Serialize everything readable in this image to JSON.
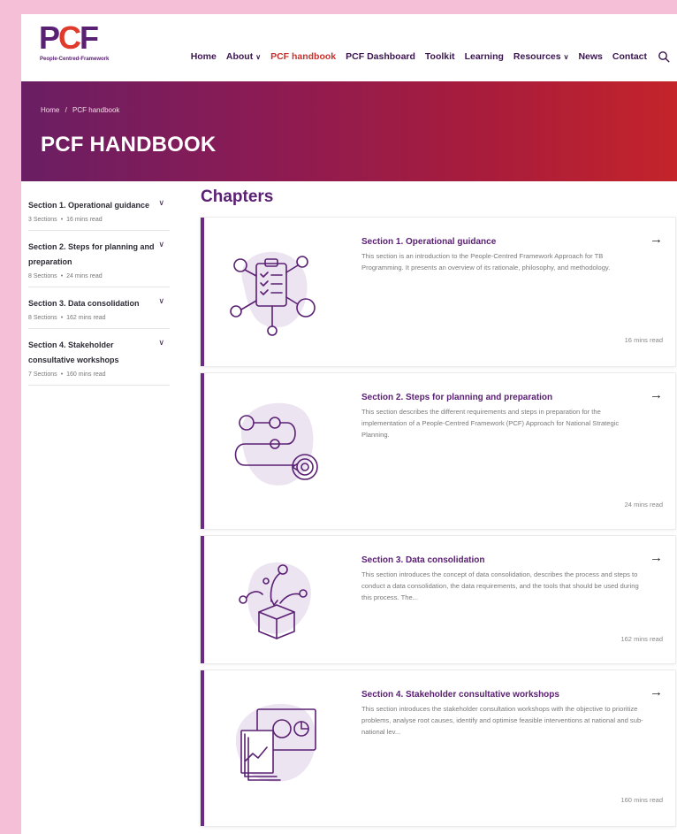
{
  "logo": {
    "letters_1": "P",
    "letters_2": "C",
    "letters_3": "F",
    "subtitle": "People-Centred-Framework"
  },
  "nav": {
    "items": [
      {
        "label": "Home",
        "dropdown": false,
        "active": false
      },
      {
        "label": "About",
        "dropdown": true,
        "active": false
      },
      {
        "label": "PCF handbook",
        "dropdown": false,
        "active": true
      },
      {
        "label": "PCF Dashboard",
        "dropdown": false,
        "active": false
      },
      {
        "label": "Toolkit",
        "dropdown": false,
        "active": false
      },
      {
        "label": "Learning",
        "dropdown": false,
        "active": false
      },
      {
        "label": "Resources",
        "dropdown": true,
        "active": false
      },
      {
        "label": "News",
        "dropdown": false,
        "active": false
      },
      {
        "label": "Contact",
        "dropdown": false,
        "active": false
      }
    ],
    "chevron": "∨"
  },
  "breadcrumb": {
    "home": "Home",
    "separator": "/",
    "current": "PCF handbook"
  },
  "hero": {
    "title": "PCF HANDBOOK"
  },
  "sidebar": {
    "items": [
      {
        "title": "Section 1. Operational guidance",
        "sections": "3 Sections",
        "read": "16 mins read"
      },
      {
        "title": "Section 2. Steps for planning and preparation",
        "sections": "8 Sections",
        "read": "24 mins read"
      },
      {
        "title": "Section 3. Data consolidation",
        "sections": "8 Sections",
        "read": "162 mins read"
      },
      {
        "title": "Section 4. Stakeholder consultative workshops",
        "sections": "7 Sections",
        "read": "160 mins read"
      }
    ],
    "bullet": "•",
    "chevron": "∨"
  },
  "main": {
    "heading": "Chapters",
    "arrow": "→",
    "cards": [
      {
        "title": "Section 1. Operational guidance",
        "description": "This section is an introduction to the People-Centred Framework Approach for TB Programming. It presents an overview of its rationale, philosophy, and methodology.",
        "read": "16 mins read",
        "illustration": "clipboard-network-icon"
      },
      {
        "title": "Section 2. Steps for planning and preparation",
        "description": "This section describes the different requirements and steps in preparation for the implementation of a People-Centred Framework (PCF) Approach for National Strategic Planning.",
        "read": "24 mins read",
        "illustration": "path-target-icon"
      },
      {
        "title": "Section 3. Data consolidation",
        "description": "This section introduces the concept of data consolidation, describes the process and steps to conduct a data consolidation, the data requirements, and the tools that should be used during this process. The...",
        "read": "162 mins read",
        "illustration": "data-box-icon"
      },
      {
        "title": "Section 4. Stakeholder consultative workshops",
        "description": "This section introduces the stakeholder consultation workshops with the objective to prioritize problems, analyse root causes, identify and optimise feasible interventions at national and sub-national lev...",
        "read": "160 mins read",
        "illustration": "presentation-charts-icon"
      }
    ]
  },
  "colors": {
    "brand_purple": "#5a2073",
    "brand_red": "#e03a2c",
    "nav_active": "#c9302c",
    "page_background": "#f6bfd8"
  }
}
